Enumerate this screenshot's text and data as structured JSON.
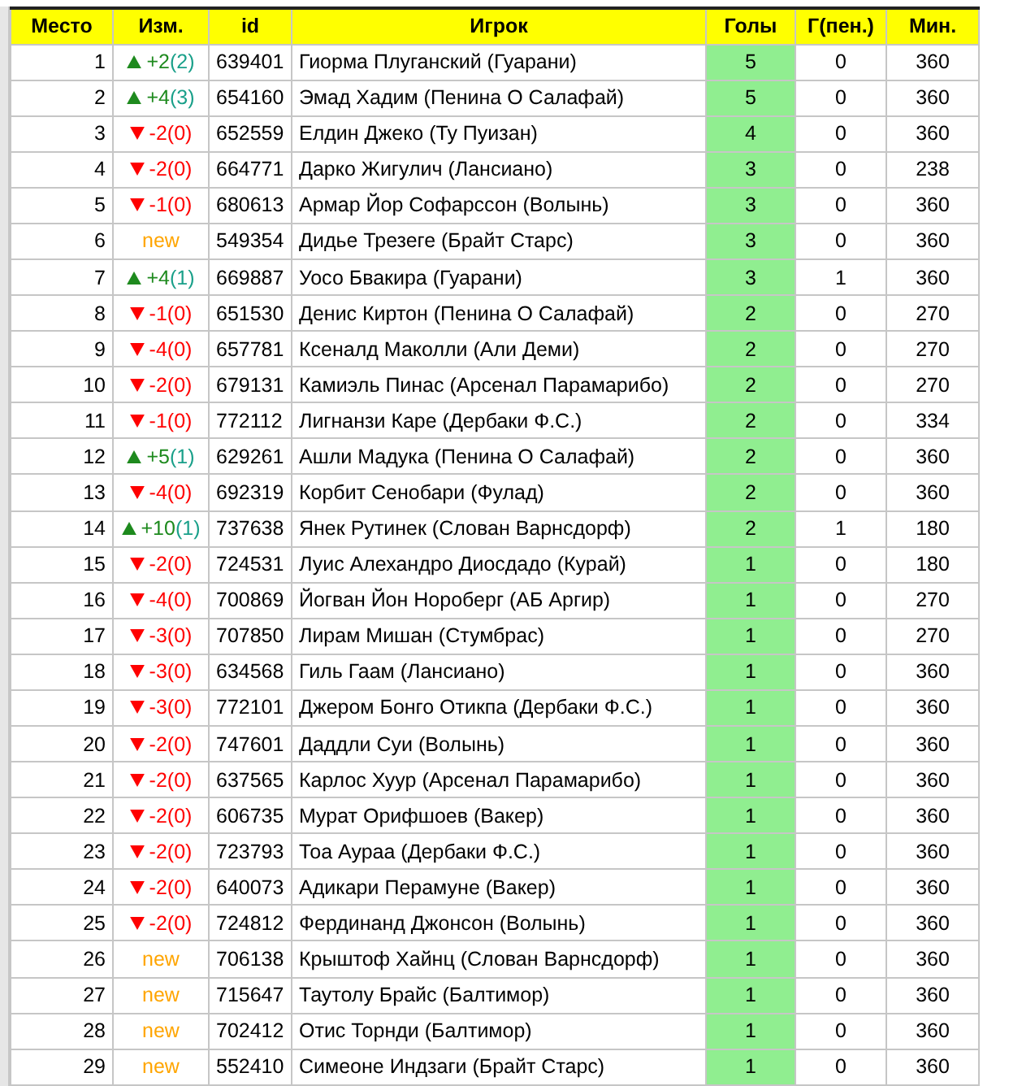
{
  "table": {
    "columns": [
      "Место",
      "Изм.",
      "id",
      "Игрок",
      "Голы",
      "Г(пен.)",
      "Мин."
    ],
    "rows": [
      {
        "place": "1",
        "change": {
          "kind": "up",
          "delta": "+2",
          "count": "(2)"
        },
        "id": "639401",
        "player": "Гиорма Плуганский (Гуарани)",
        "goals": "5",
        "pen_goals": "0",
        "minutes": "360"
      },
      {
        "place": "2",
        "change": {
          "kind": "up",
          "delta": "+4",
          "count": "(3)"
        },
        "id": "654160",
        "player": "Эмад Хадим (Пенина О Салафай)",
        "goals": "5",
        "pen_goals": "0",
        "minutes": "360"
      },
      {
        "place": "3",
        "change": {
          "kind": "down",
          "delta": "-2",
          "count": "(0)"
        },
        "id": "652559",
        "player": "Елдин Джеко (Ту Пуизан)",
        "goals": "4",
        "pen_goals": "0",
        "minutes": "360"
      },
      {
        "place": "4",
        "change": {
          "kind": "down",
          "delta": "-2",
          "count": "(0)"
        },
        "id": "664771",
        "player": "Дарко Жигулич (Лансиано)",
        "goals": "3",
        "pen_goals": "0",
        "minutes": "238"
      },
      {
        "place": "5",
        "change": {
          "kind": "down",
          "delta": "-1",
          "count": "(0)"
        },
        "id": "680613",
        "player": "Армар Йор Софарссон (Волынь)",
        "goals": "3",
        "pen_goals": "0",
        "minutes": "360"
      },
      {
        "place": "6",
        "change": {
          "kind": "new",
          "delta": "new"
        },
        "id": "549354",
        "player": "Дидье Трезеге (Брайт Старс)",
        "goals": "3",
        "pen_goals": "0",
        "minutes": "360"
      },
      {
        "place": "7",
        "change": {
          "kind": "up",
          "delta": "+4",
          "count": "(1)"
        },
        "id": "669887",
        "player": "Уосо Бвакира (Гуарани)",
        "goals": "3",
        "pen_goals": "1",
        "minutes": "360"
      },
      {
        "place": "8",
        "change": {
          "kind": "down",
          "delta": "-1",
          "count": "(0)"
        },
        "id": "651530",
        "player": "Денис Киртон (Пенина О Салафай)",
        "goals": "2",
        "pen_goals": "0",
        "minutes": "270"
      },
      {
        "place": "9",
        "change": {
          "kind": "down",
          "delta": "-4",
          "count": "(0)"
        },
        "id": "657781",
        "player": "Ксеналд Маколли (Али Деми)",
        "goals": "2",
        "pen_goals": "0",
        "minutes": "270"
      },
      {
        "place": "10",
        "change": {
          "kind": "down",
          "delta": "-2",
          "count": "(0)"
        },
        "id": "679131",
        "player": "Камиэль Пинас (Арсенал Парамарибо)",
        "goals": "2",
        "pen_goals": "0",
        "minutes": "270"
      },
      {
        "place": "11",
        "change": {
          "kind": "down",
          "delta": "-1",
          "count": "(0)"
        },
        "id": "772112",
        "player": "Лигнанзи Каре (Дербаки Ф.С.)",
        "goals": "2",
        "pen_goals": "0",
        "minutes": "334"
      },
      {
        "place": "12",
        "change": {
          "kind": "up",
          "delta": "+5",
          "count": "(1)"
        },
        "id": "629261",
        "player": "Ашли Мадука (Пенина О Салафай)",
        "goals": "2",
        "pen_goals": "0",
        "minutes": "360"
      },
      {
        "place": "13",
        "change": {
          "kind": "down",
          "delta": "-4",
          "count": "(0)"
        },
        "id": "692319",
        "player": "Корбит Сенобари (Фулад)",
        "goals": "2",
        "pen_goals": "0",
        "minutes": "360"
      },
      {
        "place": "14",
        "change": {
          "kind": "up",
          "delta": "+10",
          "count": "(1)"
        },
        "id": "737638",
        "player": "Янек Рутинек (Слован Варнсдорф)",
        "goals": "2",
        "pen_goals": "1",
        "minutes": "180"
      },
      {
        "place": "15",
        "change": {
          "kind": "down",
          "delta": "-2",
          "count": "(0)"
        },
        "id": "724531",
        "player": "Луис Алехандро Диосдадо (Курай)",
        "goals": "1",
        "pen_goals": "0",
        "minutes": "180"
      },
      {
        "place": "16",
        "change": {
          "kind": "down",
          "delta": "-4",
          "count": "(0)"
        },
        "id": "700869",
        "player": "Йогван Йон Нороберг (АБ Аргир)",
        "goals": "1",
        "pen_goals": "0",
        "minutes": "270"
      },
      {
        "place": "17",
        "change": {
          "kind": "down",
          "delta": "-3",
          "count": "(0)"
        },
        "id": "707850",
        "player": "Лирам Мишан (Стумбрас)",
        "goals": "1",
        "pen_goals": "0",
        "minutes": "270"
      },
      {
        "place": "18",
        "change": {
          "kind": "down",
          "delta": "-3",
          "count": "(0)"
        },
        "id": "634568",
        "player": "Гиль Гаам (Лансиано)",
        "goals": "1",
        "pen_goals": "0",
        "minutes": "360"
      },
      {
        "place": "19",
        "change": {
          "kind": "down",
          "delta": "-3",
          "count": "(0)"
        },
        "id": "772101",
        "player": "Джером Бонго Отикпа (Дербаки Ф.С.)",
        "goals": "1",
        "pen_goals": "0",
        "minutes": "360"
      },
      {
        "place": "20",
        "change": {
          "kind": "down",
          "delta": "-2",
          "count": "(0)"
        },
        "id": "747601",
        "player": "Даддли Суи (Волынь)",
        "goals": "1",
        "pen_goals": "0",
        "minutes": "360"
      },
      {
        "place": "21",
        "change": {
          "kind": "down",
          "delta": "-2",
          "count": "(0)"
        },
        "id": "637565",
        "player": "Карлос Хуур (Арсенал Парамарибо)",
        "goals": "1",
        "pen_goals": "0",
        "minutes": "360"
      },
      {
        "place": "22",
        "change": {
          "kind": "down",
          "delta": "-2",
          "count": "(0)"
        },
        "id": "606735",
        "player": "Мурат Орифшоев (Вакер)",
        "goals": "1",
        "pen_goals": "0",
        "minutes": "360"
      },
      {
        "place": "23",
        "change": {
          "kind": "down",
          "delta": "-2",
          "count": "(0)"
        },
        "id": "723793",
        "player": "Тоа Аураа (Дербаки Ф.С.)",
        "goals": "1",
        "pen_goals": "0",
        "minutes": "360"
      },
      {
        "place": "24",
        "change": {
          "kind": "down",
          "delta": "-2",
          "count": "(0)"
        },
        "id": "640073",
        "player": "Адикари Перамуне (Вакер)",
        "goals": "1",
        "pen_goals": "0",
        "minutes": "360"
      },
      {
        "place": "25",
        "change": {
          "kind": "down",
          "delta": "-2",
          "count": "(0)"
        },
        "id": "724812",
        "player": "Фердинанд Джонсон (Волынь)",
        "goals": "1",
        "pen_goals": "0",
        "minutes": "360"
      },
      {
        "place": "26",
        "change": {
          "kind": "new",
          "delta": "new"
        },
        "id": "706138",
        "player": "Крыштоф Хайнц (Слован Варнсдорф)",
        "goals": "1",
        "pen_goals": "0",
        "minutes": "360"
      },
      {
        "place": "27",
        "change": {
          "kind": "new",
          "delta": "new"
        },
        "id": "715647",
        "player": "Таутолу Брайс (Балтимор)",
        "goals": "1",
        "pen_goals": "0",
        "minutes": "360"
      },
      {
        "place": "28",
        "change": {
          "kind": "new",
          "delta": "new"
        },
        "id": "702412",
        "player": "Отис Торнди (Балтимор)",
        "goals": "1",
        "pen_goals": "0",
        "minutes": "360"
      },
      {
        "place": "29",
        "change": {
          "kind": "new",
          "delta": "new"
        },
        "id": "552410",
        "player": "Симеоне Индзаги (Брайт Старс)",
        "goals": "1",
        "pen_goals": "0",
        "minutes": "360"
      }
    ]
  }
}
